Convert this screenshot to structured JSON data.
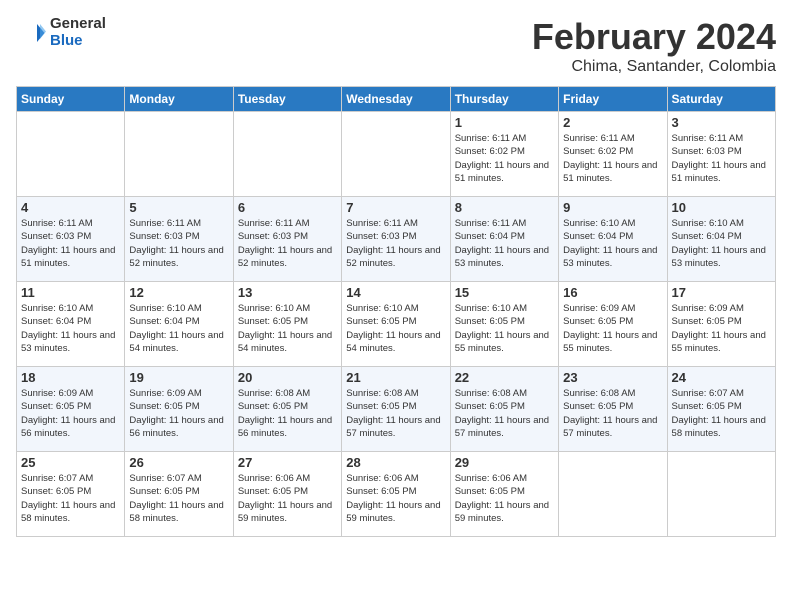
{
  "header": {
    "logo_general": "General",
    "logo_blue": "Blue",
    "month_title": "February 2024",
    "location": "Chima, Santander, Colombia"
  },
  "weekdays": [
    "Sunday",
    "Monday",
    "Tuesday",
    "Wednesday",
    "Thursday",
    "Friday",
    "Saturday"
  ],
  "weeks": [
    [
      {
        "day": "",
        "empty": true
      },
      {
        "day": "",
        "empty": true
      },
      {
        "day": "",
        "empty": true
      },
      {
        "day": "",
        "empty": true
      },
      {
        "day": "1",
        "sunrise": "Sunrise: 6:11 AM",
        "sunset": "Sunset: 6:02 PM",
        "daylight": "Daylight: 11 hours and 51 minutes."
      },
      {
        "day": "2",
        "sunrise": "Sunrise: 6:11 AM",
        "sunset": "Sunset: 6:02 PM",
        "daylight": "Daylight: 11 hours and 51 minutes."
      },
      {
        "day": "3",
        "sunrise": "Sunrise: 6:11 AM",
        "sunset": "Sunset: 6:03 PM",
        "daylight": "Daylight: 11 hours and 51 minutes."
      }
    ],
    [
      {
        "day": "4",
        "sunrise": "Sunrise: 6:11 AM",
        "sunset": "Sunset: 6:03 PM",
        "daylight": "Daylight: 11 hours and 51 minutes."
      },
      {
        "day": "5",
        "sunrise": "Sunrise: 6:11 AM",
        "sunset": "Sunset: 6:03 PM",
        "daylight": "Daylight: 11 hours and 52 minutes."
      },
      {
        "day": "6",
        "sunrise": "Sunrise: 6:11 AM",
        "sunset": "Sunset: 6:03 PM",
        "daylight": "Daylight: 11 hours and 52 minutes."
      },
      {
        "day": "7",
        "sunrise": "Sunrise: 6:11 AM",
        "sunset": "Sunset: 6:03 PM",
        "daylight": "Daylight: 11 hours and 52 minutes."
      },
      {
        "day": "8",
        "sunrise": "Sunrise: 6:11 AM",
        "sunset": "Sunset: 6:04 PM",
        "daylight": "Daylight: 11 hours and 53 minutes."
      },
      {
        "day": "9",
        "sunrise": "Sunrise: 6:10 AM",
        "sunset": "Sunset: 6:04 PM",
        "daylight": "Daylight: 11 hours and 53 minutes."
      },
      {
        "day": "10",
        "sunrise": "Sunrise: 6:10 AM",
        "sunset": "Sunset: 6:04 PM",
        "daylight": "Daylight: 11 hours and 53 minutes."
      }
    ],
    [
      {
        "day": "11",
        "sunrise": "Sunrise: 6:10 AM",
        "sunset": "Sunset: 6:04 PM",
        "daylight": "Daylight: 11 hours and 53 minutes."
      },
      {
        "day": "12",
        "sunrise": "Sunrise: 6:10 AM",
        "sunset": "Sunset: 6:04 PM",
        "daylight": "Daylight: 11 hours and 54 minutes."
      },
      {
        "day": "13",
        "sunrise": "Sunrise: 6:10 AM",
        "sunset": "Sunset: 6:05 PM",
        "daylight": "Daylight: 11 hours and 54 minutes."
      },
      {
        "day": "14",
        "sunrise": "Sunrise: 6:10 AM",
        "sunset": "Sunset: 6:05 PM",
        "daylight": "Daylight: 11 hours and 54 minutes."
      },
      {
        "day": "15",
        "sunrise": "Sunrise: 6:10 AM",
        "sunset": "Sunset: 6:05 PM",
        "daylight": "Daylight: 11 hours and 55 minutes."
      },
      {
        "day": "16",
        "sunrise": "Sunrise: 6:09 AM",
        "sunset": "Sunset: 6:05 PM",
        "daylight": "Daylight: 11 hours and 55 minutes."
      },
      {
        "day": "17",
        "sunrise": "Sunrise: 6:09 AM",
        "sunset": "Sunset: 6:05 PM",
        "daylight": "Daylight: 11 hours and 55 minutes."
      }
    ],
    [
      {
        "day": "18",
        "sunrise": "Sunrise: 6:09 AM",
        "sunset": "Sunset: 6:05 PM",
        "daylight": "Daylight: 11 hours and 56 minutes."
      },
      {
        "day": "19",
        "sunrise": "Sunrise: 6:09 AM",
        "sunset": "Sunset: 6:05 PM",
        "daylight": "Daylight: 11 hours and 56 minutes."
      },
      {
        "day": "20",
        "sunrise": "Sunrise: 6:08 AM",
        "sunset": "Sunset: 6:05 PM",
        "daylight": "Daylight: 11 hours and 56 minutes."
      },
      {
        "day": "21",
        "sunrise": "Sunrise: 6:08 AM",
        "sunset": "Sunset: 6:05 PM",
        "daylight": "Daylight: 11 hours and 57 minutes."
      },
      {
        "day": "22",
        "sunrise": "Sunrise: 6:08 AM",
        "sunset": "Sunset: 6:05 PM",
        "daylight": "Daylight: 11 hours and 57 minutes."
      },
      {
        "day": "23",
        "sunrise": "Sunrise: 6:08 AM",
        "sunset": "Sunset: 6:05 PM",
        "daylight": "Daylight: 11 hours and 57 minutes."
      },
      {
        "day": "24",
        "sunrise": "Sunrise: 6:07 AM",
        "sunset": "Sunset: 6:05 PM",
        "daylight": "Daylight: 11 hours and 58 minutes."
      }
    ],
    [
      {
        "day": "25",
        "sunrise": "Sunrise: 6:07 AM",
        "sunset": "Sunset: 6:05 PM",
        "daylight": "Daylight: 11 hours and 58 minutes."
      },
      {
        "day": "26",
        "sunrise": "Sunrise: 6:07 AM",
        "sunset": "Sunset: 6:05 PM",
        "daylight": "Daylight: 11 hours and 58 minutes."
      },
      {
        "day": "27",
        "sunrise": "Sunrise: 6:06 AM",
        "sunset": "Sunset: 6:05 PM",
        "daylight": "Daylight: 11 hours and 59 minutes."
      },
      {
        "day": "28",
        "sunrise": "Sunrise: 6:06 AM",
        "sunset": "Sunset: 6:05 PM",
        "daylight": "Daylight: 11 hours and 59 minutes."
      },
      {
        "day": "29",
        "sunrise": "Sunrise: 6:06 AM",
        "sunset": "Sunset: 6:05 PM",
        "daylight": "Daylight: 11 hours and 59 minutes."
      },
      {
        "day": "",
        "empty": true
      },
      {
        "day": "",
        "empty": true
      }
    ]
  ]
}
